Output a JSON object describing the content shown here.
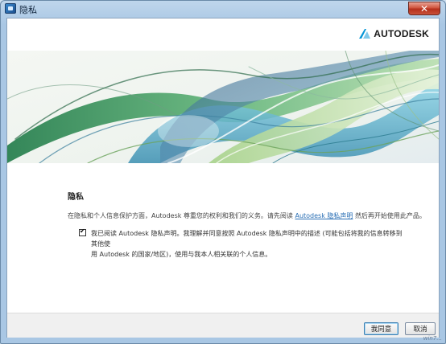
{
  "window": {
    "title": "隐私",
    "close_label": "✕"
  },
  "brand": {
    "logo_text": "AUTODESK",
    "accent": "#0696d7"
  },
  "page": {
    "heading": "隐私",
    "intro_before": "在隐私和个人信息保护方面，Autodesk 尊重您的权利和我们的义务。请先阅读",
    "intro_link": "Autodesk 隐私声明",
    "intro_after": "然后再开始使用此产品。",
    "agreement_checked": true,
    "agreement_line1": "我已阅读 Autodesk 隐私声明。我理解并同意按照 Autodesk 隐私声明中的描述 (可能包括将我的信息转移到其他使",
    "agreement_line2": "用 Autodesk 的国家/地区)，使用与我本人相关联的个人信息。"
  },
  "buttons": {
    "agree": "我同意",
    "cancel": "取消"
  },
  "watermark": "win7..."
}
